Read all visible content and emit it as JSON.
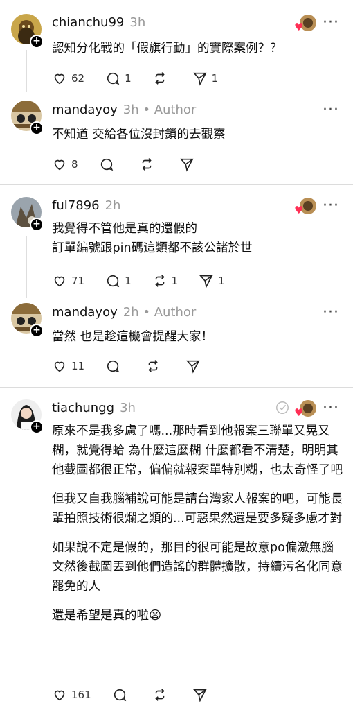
{
  "comments": [
    {
      "username": "chianchu99",
      "time": "3h",
      "author_label": "",
      "lines": [
        "認知分化戰的「假旗行動」的實際案例？？"
      ],
      "likes": "62",
      "replies": "1",
      "reposts": "",
      "shares": "1"
    },
    {
      "username": "mandayoy",
      "time": "3h",
      "author_label": "• Author",
      "lines": [
        "不知道  交給各位沒封鎖的去觀察"
      ],
      "likes": "8",
      "replies": "",
      "reposts": "",
      "shares": ""
    },
    {
      "username": "ful7896",
      "time": "2h",
      "author_label": "",
      "lines": [
        "我覺得不管他是真的還假的",
        "訂單編號跟pin碼這類都不該公諸於世"
      ],
      "likes": "71",
      "replies": "1",
      "reposts": "1",
      "shares": "1"
    },
    {
      "username": "mandayoy",
      "time": "2h",
      "author_label": "• Author",
      "lines": [
        "當然  也是趁這機會提醒大家！"
      ],
      "likes": "11",
      "replies": "",
      "reposts": "",
      "shares": ""
    },
    {
      "username": "tiachungg",
      "time": "3h",
      "author_label": "",
      "paragraphs": [
        "原來不是我多慮了嗎...那時看到他報案三聯單又晃又糊，就覺得蛤 為什麼這麼糊 什麼都看不清楚，明明其他截圖都很正常，偏偏就報案單特別糊，也太奇怪了吧",
        "但我又自我腦補說可能是請台灣家人報案的吧，可能長輩拍照技術很爛之類的...可惡果然還是要多疑多慮才對",
        "如果說不定是假的，那目的很可能是故意po偏激無腦文然後截圖丟到他們造謠的群體擴散，持續污名化同意罷免的人",
        "還是希望是真的啦😫"
      ],
      "likes": "161",
      "replies": "",
      "reposts": "",
      "shares": ""
    }
  ],
  "icons": {
    "like": "heart-icon",
    "reply": "comment-icon",
    "repost": "repost-icon",
    "share": "send-icon",
    "more": "more-icon",
    "follow": "plus-icon"
  },
  "symbols": {
    "more": "···",
    "plus": "+",
    "heart": "♥"
  },
  "colors": {
    "heart_badge": "#ff2f55",
    "muted": "#999999",
    "separator": "#dcdcdc"
  }
}
